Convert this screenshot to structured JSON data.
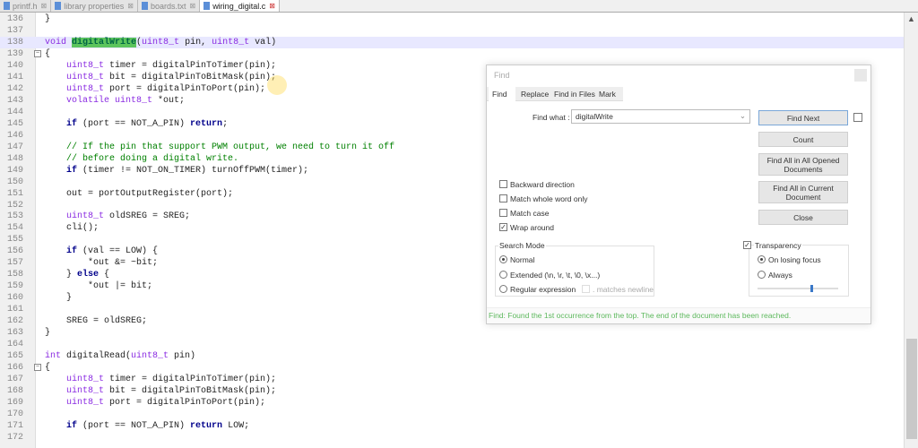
{
  "tabs": [
    {
      "label": "printf.h",
      "active": false
    },
    {
      "label": "library properties",
      "active": false
    },
    {
      "label": "boards.txt",
      "active": false
    },
    {
      "label": "wiring_digital.c",
      "active": true
    }
  ],
  "code": [
    {
      "n": "136",
      "s": [
        [
          "}",
          ""
        ]
      ]
    },
    {
      "n": "137",
      "s": []
    },
    {
      "n": "138",
      "cur": true,
      "s": [
        [
          "void ",
          "ty"
        ],
        [
          "digitalWrite",
          "hl"
        ],
        [
          "(",
          ""
        ],
        [
          "uint8_t",
          "ty"
        ],
        [
          " pin, ",
          ""
        ],
        [
          "uint8_t",
          "ty"
        ],
        [
          " val)",
          ""
        ]
      ]
    },
    {
      "n": "139",
      "fold": true,
      "s": [
        [
          "{",
          ""
        ]
      ]
    },
    {
      "n": "140",
      "s": [
        [
          "    uint8_t",
          "ty"
        ],
        [
          " timer = digitalPinToTimer(pin);",
          ""
        ]
      ]
    },
    {
      "n": "141",
      "s": [
        [
          "    uint8_t",
          "ty"
        ],
        [
          " bit = digitalPinToBitMask(pin);",
          ""
        ]
      ]
    },
    {
      "n": "142",
      "s": [
        [
          "    uint8_t",
          "ty"
        ],
        [
          " port = digitalPinToPort(pin);",
          ""
        ]
      ]
    },
    {
      "n": "143",
      "s": [
        [
          "    volatile uint8_t",
          "ty"
        ],
        [
          " *out;",
          ""
        ]
      ]
    },
    {
      "n": "144",
      "s": []
    },
    {
      "n": "145",
      "s": [
        [
          "    if",
          "kw"
        ],
        [
          " (port == NOT_A_PIN) ",
          ""
        ],
        [
          "return",
          "kw"
        ],
        [
          ";",
          ""
        ]
      ]
    },
    {
      "n": "146",
      "s": []
    },
    {
      "n": "147",
      "s": [
        [
          "    // If the pin that support PWM output, we need to turn it off",
          "cm"
        ]
      ]
    },
    {
      "n": "148",
      "s": [
        [
          "    // before doing a digital write.",
          "cm"
        ]
      ]
    },
    {
      "n": "149",
      "s": [
        [
          "    if",
          "kw"
        ],
        [
          " (timer != NOT_ON_TIMER) turnOffPWM(timer);",
          ""
        ]
      ]
    },
    {
      "n": "150",
      "s": []
    },
    {
      "n": "151",
      "s": [
        [
          "    out = portOutputRegister(port);",
          ""
        ]
      ]
    },
    {
      "n": "152",
      "s": []
    },
    {
      "n": "153",
      "s": [
        [
          "    uint8_t",
          "ty"
        ],
        [
          " oldSREG = SREG;",
          ""
        ]
      ]
    },
    {
      "n": "154",
      "s": [
        [
          "    cli();",
          ""
        ]
      ]
    },
    {
      "n": "155",
      "s": []
    },
    {
      "n": "156",
      "s": [
        [
          "    if",
          "kw"
        ],
        [
          " (val == LOW) {",
          ""
        ]
      ]
    },
    {
      "n": "157",
      "s": [
        [
          "        *out &= ~bit;",
          ""
        ]
      ]
    },
    {
      "n": "158",
      "s": [
        [
          "    } ",
          ""
        ],
        [
          "else",
          "kw"
        ],
        [
          " {",
          ""
        ]
      ]
    },
    {
      "n": "159",
      "s": [
        [
          "        *out |= bit;",
          ""
        ]
      ]
    },
    {
      "n": "160",
      "s": [
        [
          "    }",
          ""
        ]
      ]
    },
    {
      "n": "161",
      "s": []
    },
    {
      "n": "162",
      "s": [
        [
          "    SREG = oldSREG;",
          ""
        ]
      ]
    },
    {
      "n": "163",
      "s": [
        [
          "}",
          ""
        ]
      ]
    },
    {
      "n": "164",
      "s": []
    },
    {
      "n": "165",
      "s": [
        [
          "int",
          "ty"
        ],
        [
          " digitalRead(",
          ""
        ],
        [
          "uint8_t",
          "ty"
        ],
        [
          " pin)",
          ""
        ]
      ]
    },
    {
      "n": "166",
      "fold": true,
      "s": [
        [
          "{",
          ""
        ]
      ]
    },
    {
      "n": "167",
      "s": [
        [
          "    uint8_t",
          "ty"
        ],
        [
          " timer = digitalPinToTimer(pin);",
          ""
        ]
      ]
    },
    {
      "n": "168",
      "s": [
        [
          "    uint8_t",
          "ty"
        ],
        [
          " bit = digitalPinToBitMask(pin);",
          ""
        ]
      ]
    },
    {
      "n": "169",
      "s": [
        [
          "    uint8_t",
          "ty"
        ],
        [
          " port = digitalPinToPort(pin);",
          ""
        ]
      ]
    },
    {
      "n": "170",
      "s": []
    },
    {
      "n": "171",
      "s": [
        [
          "    if",
          "kw"
        ],
        [
          " (port == NOT_A_PIN) ",
          ""
        ],
        [
          "return",
          "kw"
        ],
        [
          " LOW;",
          ""
        ]
      ]
    },
    {
      "n": "172",
      "s": []
    }
  ],
  "find": {
    "title": "Find",
    "tabs": [
      "Find",
      "Replace",
      "Find in Files",
      "Mark"
    ],
    "find_what_label": "Find what :",
    "find_what_value": "digitalWrite",
    "buttons": {
      "find_next": "Find Next",
      "count": "Count",
      "find_all_opened": "Find All in All Opened Documents",
      "find_all_current": "Find All in Current Document",
      "close": "Close"
    },
    "options": {
      "backward": "Backward direction",
      "whole_word": "Match whole word only",
      "match_case": "Match case",
      "wrap": "Wrap around"
    },
    "option_states": {
      "backward": false,
      "whole_word": false,
      "match_case": false,
      "wrap": true
    },
    "search_mode": {
      "title": "Search Mode",
      "normal": "Normal",
      "extended": "Extended (\\n, \\r, \\t, \\0, \\x...)",
      "regex": "Regular expression",
      "matches_newline": ". matches newline",
      "selected": "Normal"
    },
    "transparency": {
      "label": "Transparency",
      "checked": true,
      "on_losing_focus": "On losing focus",
      "always": "Always",
      "selected": "On losing focus",
      "level": 0.65
    },
    "status": "Find: Found the 1st occurrence from the top. The end of the document has been reached.",
    "status_color": "#5cb85c"
  }
}
